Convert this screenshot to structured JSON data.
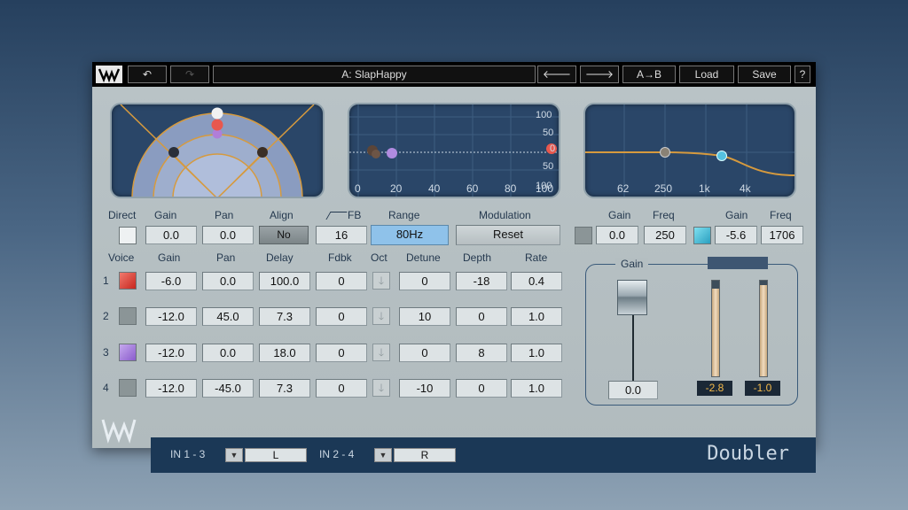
{
  "titlebar": {
    "undo_icon": "undo-icon",
    "redo_icon": "redo-icon",
    "preset_name": "A: SlapHappy",
    "prev_icon": "arrow-left-icon",
    "next_icon": "arrow-right-icon",
    "ab_label": "A→B",
    "load_label": "Load",
    "save_label": "Save",
    "help_label": "?"
  },
  "graph_freq": {
    "y_ticks": [
      "100",
      "50",
      "0",
      "50",
      "100"
    ],
    "x_ticks": [
      "0",
      "20",
      "40",
      "60",
      "80",
      "100"
    ]
  },
  "graph_eq": {
    "x_ticks": [
      "62",
      "250",
      "1k",
      "4k"
    ]
  },
  "direct": {
    "direct_label": "Direct",
    "gain_label": "Gain",
    "pan_label": "Pan",
    "align_label": "Align",
    "fb_label": "FB",
    "range_label": "Range",
    "modulation_label": "Modulation",
    "gain": "0.0",
    "pan": "0.0",
    "align": "No",
    "fb": "16",
    "range": "80Hz",
    "modulation": "Reset"
  },
  "eq": {
    "gain_label_1": "Gain",
    "freq_label_1": "Freq",
    "gain_label_2": "Gain",
    "freq_label_2": "Freq",
    "gain1": "0.0",
    "freq1": "250",
    "gain2": "-5.6",
    "freq2": "1706"
  },
  "voices_header": {
    "voice": "Voice",
    "gain": "Gain",
    "pan": "Pan",
    "delay": "Delay",
    "fdbk": "Fdbk",
    "oct": "Oct",
    "detune": "Detune",
    "depth": "Depth",
    "rate": "Rate"
  },
  "voices": [
    {
      "num": "1",
      "gain": "-6.0",
      "pan": "0.0",
      "delay": "100.0",
      "fdbk": "0",
      "detune": "0",
      "depth": "-18",
      "rate": "0.4",
      "color": "#e8403a"
    },
    {
      "num": "2",
      "gain": "-12.0",
      "pan": "45.0",
      "delay": "7.3",
      "fdbk": "0",
      "detune": "10",
      "depth": "0",
      "rate": "1.0",
      "color": "#8b9597"
    },
    {
      "num": "3",
      "gain": "-12.0",
      "pan": "0.0",
      "delay": "18.0",
      "fdbk": "0",
      "detune": "0",
      "depth": "8",
      "rate": "1.0",
      "color": "#9a78d0"
    },
    {
      "num": "4",
      "gain": "-12.0",
      "pan": "-45.0",
      "delay": "7.3",
      "fdbk": "0",
      "detune": "-10",
      "depth": "0",
      "rate": "1.0",
      "color": "#8b9597"
    }
  ],
  "master": {
    "gain_label": "Gain",
    "gain_value": "0.0",
    "meter_left": "-2.8",
    "meter_right": "-1.0"
  },
  "io": {
    "in1_label": "IN 1 - 3",
    "in1_value": "L",
    "in2_label": "IN 2 - 4",
    "in2_value": "R"
  },
  "plugin_name": "Doubler",
  "colors": {
    "display_bg": "#2a4668",
    "accent_blue": "#8fc2ea",
    "meter_text": "#f3b94a"
  }
}
